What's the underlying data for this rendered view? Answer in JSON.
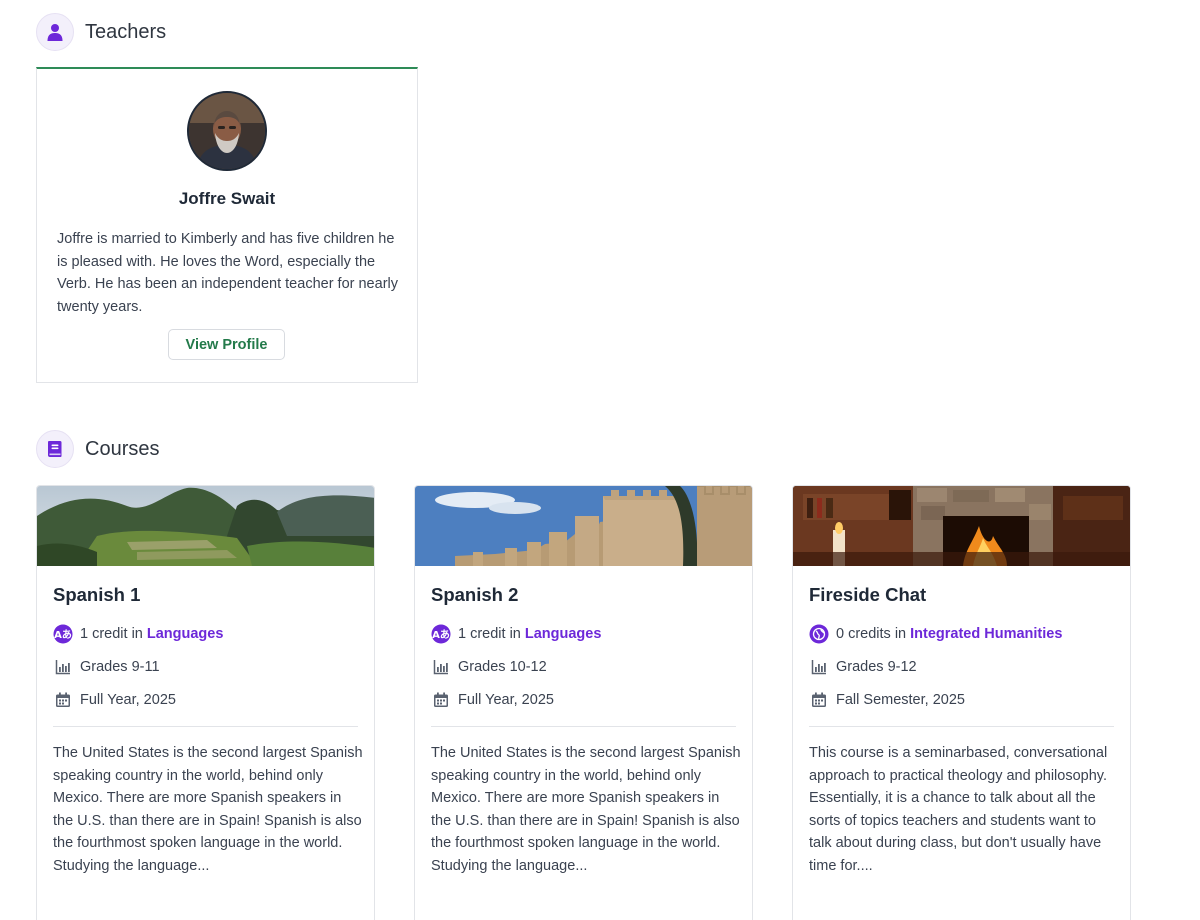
{
  "teachers_section": {
    "title": "Teachers",
    "icon": "user-icon"
  },
  "teacher": {
    "name": "Joffre Swait",
    "bio": "Joffre is married to Kimberly and has five children he is pleased with. He loves the Word, especially the Verb. He has been an independent teacher for nearly twenty years.",
    "button_label": "View Profile"
  },
  "courses_section": {
    "title": "Courses",
    "icon": "book-icon"
  },
  "courses": [
    {
      "title": "Spanish 1",
      "credits": "1 credit in",
      "subject": "Languages",
      "grades": "Grades 9-11",
      "term": "Full Year, 2025",
      "description": "The United States is the second largest Spanish speaking country in the world, behind only Mexico. There are more Spanish speakers in the U.S. than there are in Spain! Spanish is also the fourthmost spoken language in the world. Studying the language..."
    },
    {
      "title": "Spanish 2",
      "credits": "1 credit in",
      "subject": "Languages",
      "grades": "Grades 10-12",
      "term": "Full Year, 2025",
      "description": "The United States is the second largest Spanish speaking country in the world, behind only Mexico. There are more Spanish speakers in the U.S. than there are in Spain! Spanish is also the fourthmost spoken language in the world. Studying the language..."
    },
    {
      "title": "Fireside Chat",
      "credits": "0 credits in",
      "subject": "Integrated Humanities",
      "grades": "Grades 9-12",
      "term": "Fall Semester, 2025",
      "description": "This course is a seminarbased, conversational approach to practical theology and philosophy. Essentially, it is a chance to talk about all the sorts of topics teachers and students want to talk about during class, but don't usually have time for...."
    }
  ],
  "colors": {
    "accent": "#6d28d9",
    "green": "#237a4a",
    "border": "#e2e4e8"
  }
}
